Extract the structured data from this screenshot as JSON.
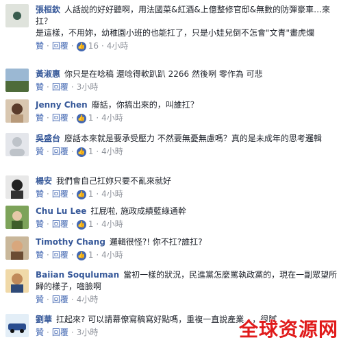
{
  "ui": {
    "like": "贊",
    "reply": "回覆"
  },
  "comments": [
    {
      "name": "張桓欽",
      "text": "人話說的好好聽啊，用法國菜&紅酒&上億整修官邸&無數的防彈豪車…來扛？\n是這樣，不用妳，幼稚園小班的也能扛了，只是小娃兒倒不怎會\"文青\"畫虎爛",
      "likes": "16",
      "time": "4小時"
    },
    {
      "name": "黃淑惠",
      "text": "你只是在唸稿 還唸得軟趴趴 2266 然後咧 零作為 可悲",
      "likes": "",
      "time": "3小時"
    },
    {
      "name": "Jenny Chen",
      "text": "廢話，你搞出來的，叫誰扛？",
      "likes": "1",
      "time": "4小時"
    },
    {
      "name": "吳盛台",
      "text": "廢話本來就是要承受壓力 不然要無憂無慮嗎？真的是未成年的思考邏輯",
      "likes": "1",
      "time": "4小時"
    },
    {
      "name": "楊安",
      "text": "我們會自己扛妳只要不亂來就好",
      "likes": "1",
      "time": "4小時"
    },
    {
      "name": "Chu Lu Lee",
      "text": "扛屁啦, 施政成績藍綠通幹",
      "likes": "1",
      "time": "4小時"
    },
    {
      "name": "Timothy Chang",
      "text": "邏輯很怪?! 你不扛?誰扛?",
      "likes": "1",
      "time": "4小時"
    },
    {
      "name": "Baiian Soquluman",
      "text": "當初一樣的狀況，民進黨怎麼罵執政黨的，現在一副眾望所歸的樣子，嚙臉啊",
      "likes": "",
      "time": "4小時"
    },
    {
      "name": "劉華",
      "text": "扛起來? 可以請幕僚寫稿寫好點嗎，重複一直說產業…，很膩",
      "likes": "",
      "time": "3小時"
    }
  ],
  "watermark": "全球资源网",
  "colors": {
    "name": "#365899",
    "link": "#4267b2",
    "meta": "#90949c",
    "watermark": "#e01b1b"
  }
}
